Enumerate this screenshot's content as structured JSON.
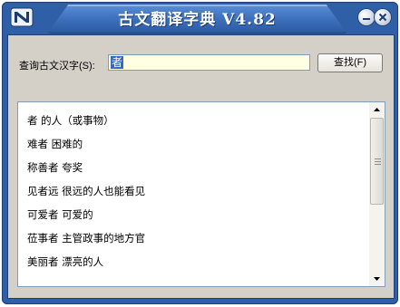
{
  "window": {
    "title": "古文翻译字典  V4.82",
    "icons": {
      "app": "app-logo-icon",
      "minimize": "minimize-icon",
      "close": "close-icon"
    }
  },
  "query": {
    "label": "查询古文汉字(S):",
    "value": "者",
    "button_label": "查找(F)"
  },
  "results": {
    "items": [
      "者 的人（或事物）",
      "难者 困难的",
      "称善者 夸奖",
      "见者远 很远的人也能看见",
      "可爱者 可爱的",
      "莅事者 主管政事的地方官",
      "美丽者 漂亮的人"
    ]
  },
  "colors": {
    "frame": "#2f5fa6",
    "panel": "#d4d0c8",
    "input_bg": "#ffffe1",
    "selection": "#316ac5"
  }
}
